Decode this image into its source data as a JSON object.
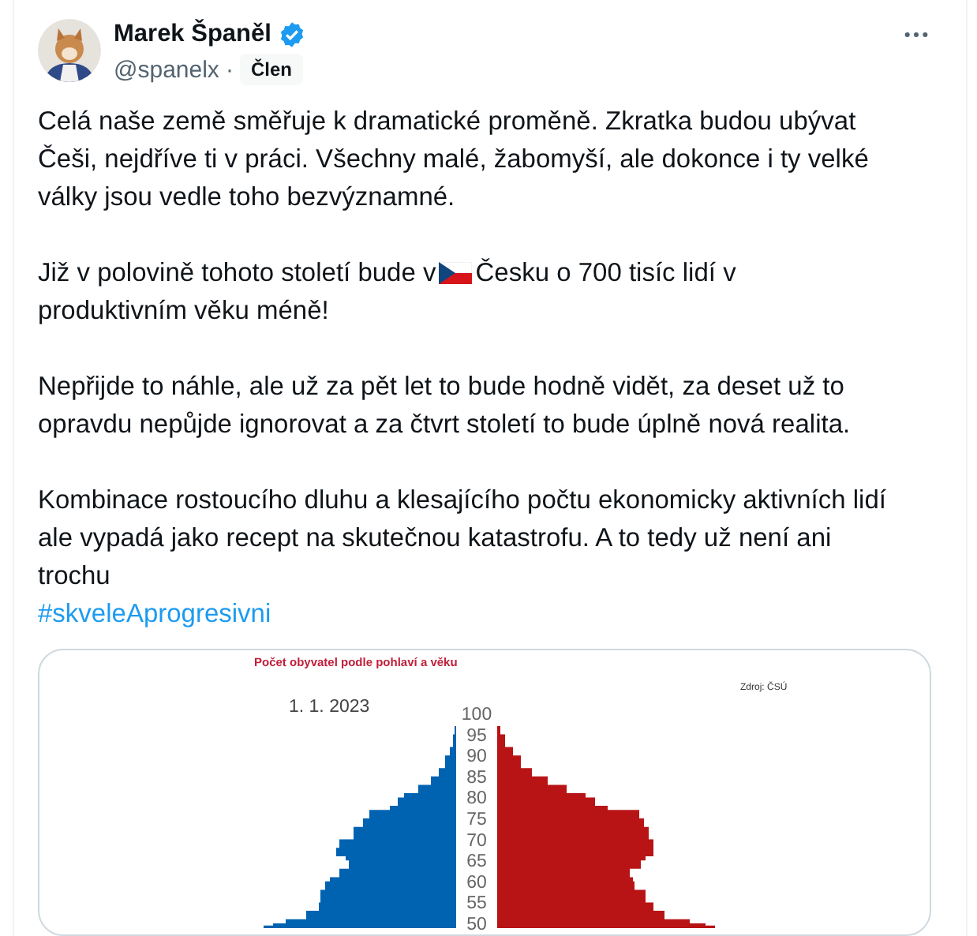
{
  "post": {
    "author": {
      "name": "Marek Španěl",
      "verified": true,
      "handle": "@spanelx",
      "separator": "·",
      "badge": "Člen"
    },
    "paragraphs": [
      {
        "kind": "text",
        "text": "Celá naše země směřuje k dramatické proměně. Zkratka budou ubývat Češi, nejdříve ti v práci. Všechny malé, žabomyší, ale dokonce i ty velké války jsou vedle toho bezvýznamné."
      },
      {
        "kind": "flag",
        "before": "Již v polovině tohoto století bude v",
        "after": "Česku o 700 tisíc lidí v",
        "continuation": "produktivním věku méně!"
      },
      {
        "kind": "text",
        "text": "Nepřijde to náhle, ale už za pět let to bude hodně vidět, za deset už to opravdu nepůjde ignorovat a za čtvrt století to bude úplně nová realita."
      },
      {
        "kind": "text",
        "text": "Kombinace rostoucího dluhu a klesajícího počtu ekonomicky aktivních lidí ale vypadá jako recept na skutečnou katastrofu. A to tedy už není ani trochu"
      }
    ],
    "hashtag": "#skveleAprogresivni",
    "image": {
      "title": "Počet obyvatel podle pohlaví a věku",
      "source": "Zdroj: ČSÚ",
      "date": "1. 1. 2023",
      "age_ticks": [
        "100",
        "95",
        "90",
        "85",
        "80",
        "75",
        "70",
        "65",
        "60",
        "55",
        "50"
      ]
    }
  }
}
